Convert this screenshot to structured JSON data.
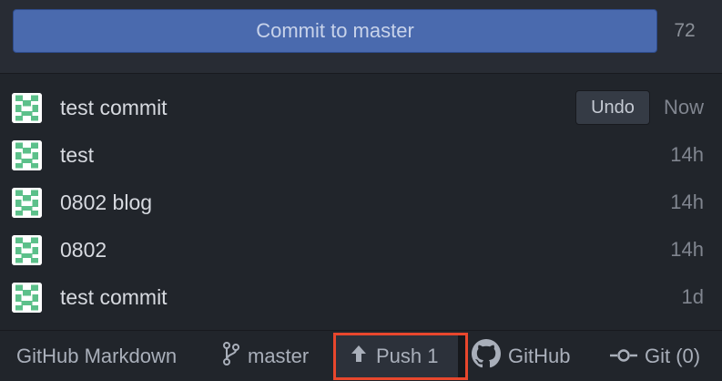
{
  "commit_panel": {
    "commit_button_label": "Commit to master",
    "remaining_chars": "72"
  },
  "commits": [
    {
      "message": "test commit",
      "time": "Now",
      "undo_label": "Undo"
    },
    {
      "message": "test",
      "time": "14h"
    },
    {
      "message": "0802 blog",
      "time": "14h"
    },
    {
      "message": "0802",
      "time": "14h"
    },
    {
      "message": "test commit",
      "time": "1d"
    }
  ],
  "status_bar": {
    "grammar": "GitHub Markdown",
    "branch": "master",
    "push_label": "Push 1",
    "github_label": "GitHub",
    "git_label": "Git (0)"
  },
  "icons": {
    "avatar": "identicon-avatar",
    "branch": "git-branch-icon",
    "push": "arrow-up-icon",
    "github": "github-octocat-icon",
    "git": "git-commit-icon"
  },
  "colors": {
    "commit_button": "#4a6aae",
    "push_highlight": "#e8472d",
    "avatar_green": "#5cc08a"
  }
}
